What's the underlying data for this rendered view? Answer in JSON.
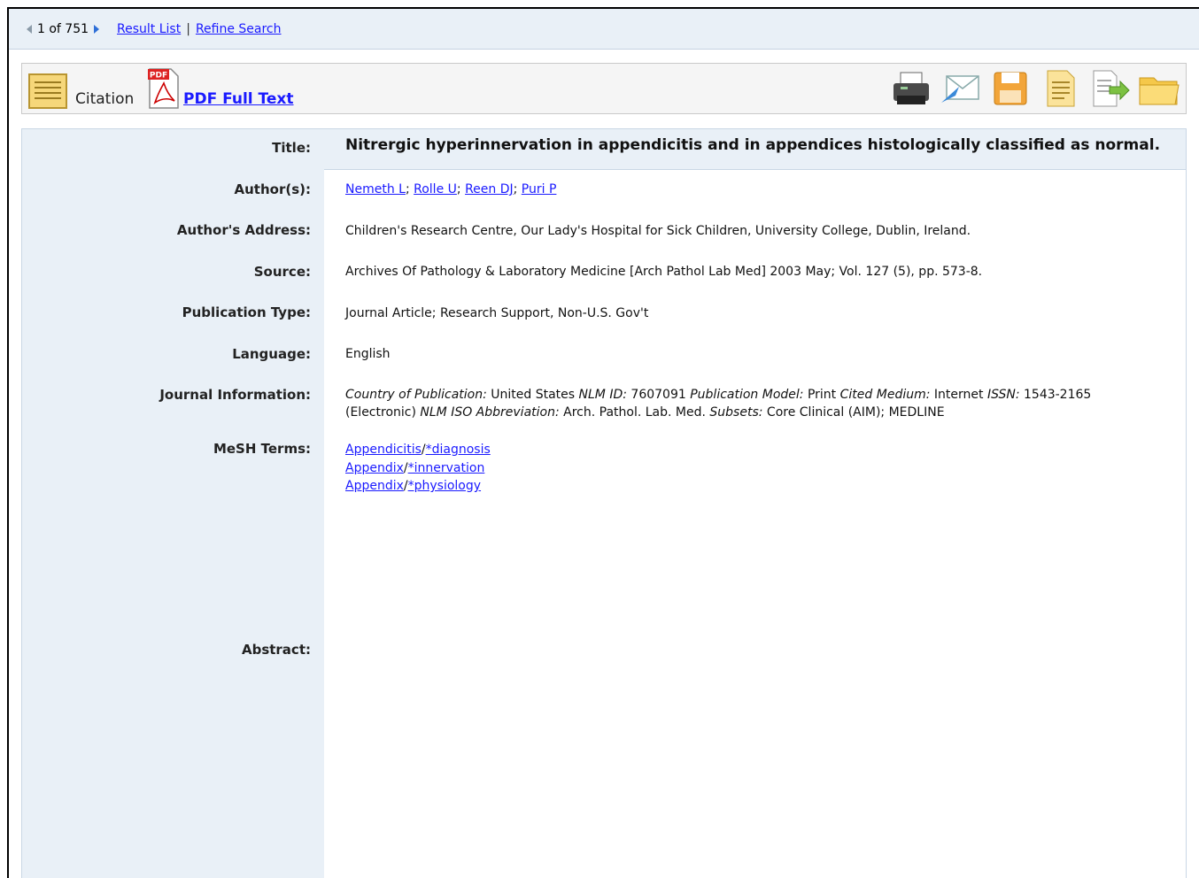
{
  "nav": {
    "position": "1 of 751",
    "result_list": "Result List",
    "separator": "|",
    "refine_search": "Refine Search"
  },
  "toolbar": {
    "citation_label": "Citation",
    "pdf_badge": "PDF",
    "pdf_label": "PDF Full Text",
    "tools": [
      "print-icon",
      "email-icon",
      "save-icon",
      "cite-icon",
      "export-icon",
      "folder-icon"
    ]
  },
  "record": {
    "title_label": "Title:",
    "title": "Nitrergic hyperinnervation in appendicitis and in appendices histologically classified as normal.",
    "authors_label": "Author(s):",
    "authors": [
      "Nemeth L",
      "Rolle U",
      "Reen DJ",
      "Puri P"
    ],
    "address_label": "Author's Address:",
    "address": "Children's Research Centre, Our Lady's Hospital for Sick Children, University College, Dublin, Ireland.",
    "source_label": "Source:",
    "source": "Archives Of Pathology & Laboratory Medicine [Arch Pathol Lab Med] 2003 May; Vol. 127 (5), pp. 573-8.",
    "pubtype_label": "Publication Type:",
    "pubtype": "Journal Article; Research Support, Non-U.S. Gov't",
    "language_label": "Language:",
    "language": "English",
    "journal_label": "Journal Information:",
    "journal": {
      "country_label": "Country of Publication:",
      "country": "United States",
      "nlmid_label": "NLM ID:",
      "nlmid": "7607091",
      "model_label": "Publication Model:",
      "model": "Print",
      "medium_label": "Cited Medium:",
      "medium": "Internet",
      "issn_label": "ISSN:",
      "issn": "1543-2165",
      "issn_type": "(Electronic)",
      "abbr_label": "NLM ISO Abbreviation:",
      "abbr": "Arch. Pathol. Lab. Med.",
      "subsets_label": "Subsets:",
      "subsets": "Core Clinical (AIM); MEDLINE"
    },
    "mesh_label": "MeSH Terms:",
    "mesh_major": [
      [
        "Appendicitis",
        "*diagnosis"
      ],
      [
        "Appendix",
        "*innervation"
      ],
      [
        "Appendix",
        "*physiology"
      ]
    ],
    "abstract_label": "Abstract:",
    "abstract_highlight": "appendix"
  }
}
